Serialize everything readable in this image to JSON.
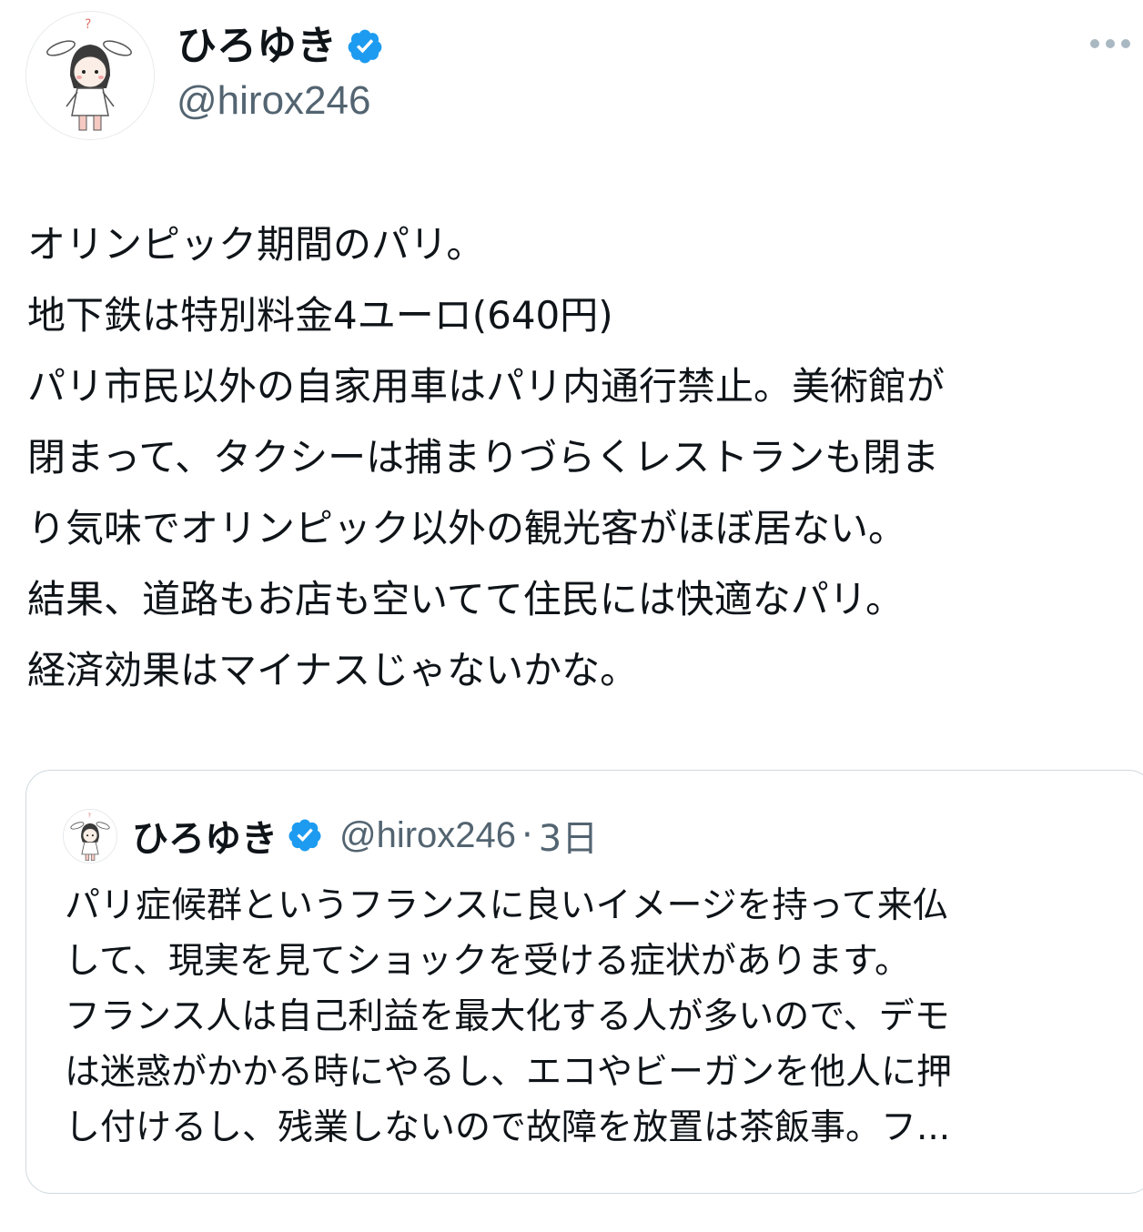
{
  "tweet": {
    "author": {
      "display_name": "ひろゆき",
      "handle": "@hirox246",
      "verified": true,
      "avatar_icon": "bunny-ear-character-avatar"
    },
    "more_icon": "more-horizontal-icon",
    "body_lines": [
      "オリンピック期間のパリ。",
      "地下鉄は特別料金4ユーロ(640円)",
      "パリ市民以外の自家用車はパリ内通行禁止。美術館が",
      "閉まって、タクシーは捕まりづらくレストランも閉ま",
      "り気味でオリンピック以外の観光客がほぼ居ない。",
      "結果、道路もお店も空いてて住民には快適なパリ。",
      "経済効果はマイナスじゃないかな。"
    ]
  },
  "quoted_tweet": {
    "author": {
      "display_name": "ひろゆき",
      "handle": "@hirox246",
      "verified": true
    },
    "separator": "·",
    "time": "3日",
    "body_lines": [
      "パリ症候群というフランスに良いイメージを持って来仏",
      "して、現実を見てショックを受ける症状があります。",
      "フランス人は自己利益を最大化する人が多いので、デモ",
      "は迷惑がかかる時にやるし、エコやビーガンを他人に押",
      "し付けるし、残業しないので故障を放置は茶飯事。フ..."
    ]
  },
  "colors": {
    "text_primary": "#0f1419",
    "text_secondary": "#536471",
    "verified_blue": "#1d9bf0",
    "border": "#cfd9de"
  }
}
